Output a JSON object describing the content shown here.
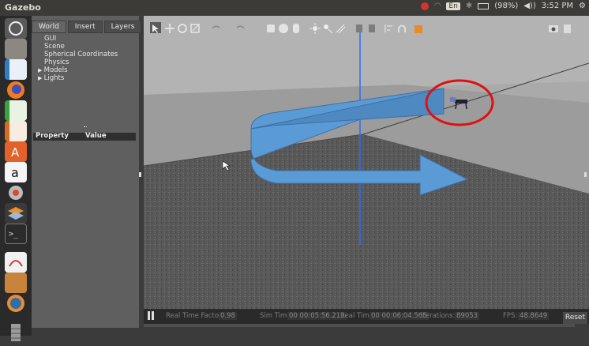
{
  "window": {
    "title": "Gazebo"
  },
  "tray": {
    "lang": "En",
    "battery": "(98%)",
    "clock": "3:52 PM"
  },
  "left_panel": {
    "tabs": [
      "World",
      "Insert",
      "Layers"
    ],
    "tree": [
      "GUI",
      "Scene",
      "Spherical Coordinates",
      "Physics",
      "Models",
      "Lights"
    ],
    "property_header": "Property",
    "value_header": "Value"
  },
  "status": {
    "rtf_label": "Real Time Factor:",
    "rtf_value": "0.98",
    "sim_label": "Sim Time:",
    "sim_value": "00 00:05:56.213",
    "real_label": "Real Time:",
    "real_value": "00 00:06:04.565",
    "iter_label": "Iterations:",
    "iter_value": "89053",
    "fps_label": "FPS:",
    "fps_value": "48.8649",
    "reset": "Reset"
  },
  "colors": {
    "floor": "#595959",
    "arrow": "#5b9bd5",
    "highlight_circle": "#e01010",
    "axis_line": "#2f6cf5"
  },
  "icons": {
    "launcher": [
      "ubuntu-dash-icon",
      "files-icon",
      "writer-icon",
      "firefox-icon",
      "calc-icon",
      "impress-icon",
      "software-center-icon",
      "amazon-icon",
      "settings-icon",
      "layers-icon",
      "terminal-icon",
      "text-editor-icon",
      "package-icon",
      "gazebo-icon",
      "trash-icon"
    ],
    "toolbar": [
      "select-mode-icon",
      "translate-mode-icon",
      "rotate-mode-icon",
      "scale-mode-icon",
      "undo-icon",
      "redo-icon",
      "box-shape-icon",
      "sphere-shape-icon",
      "cylinder-shape-icon",
      "point-light-icon",
      "spot-light-icon",
      "directional-light-icon",
      "copy-icon",
      "paste-icon",
      "align-icon",
      "snap-icon",
      "view-angle-icon",
      "screenshot-icon",
      "record-icon"
    ]
  }
}
